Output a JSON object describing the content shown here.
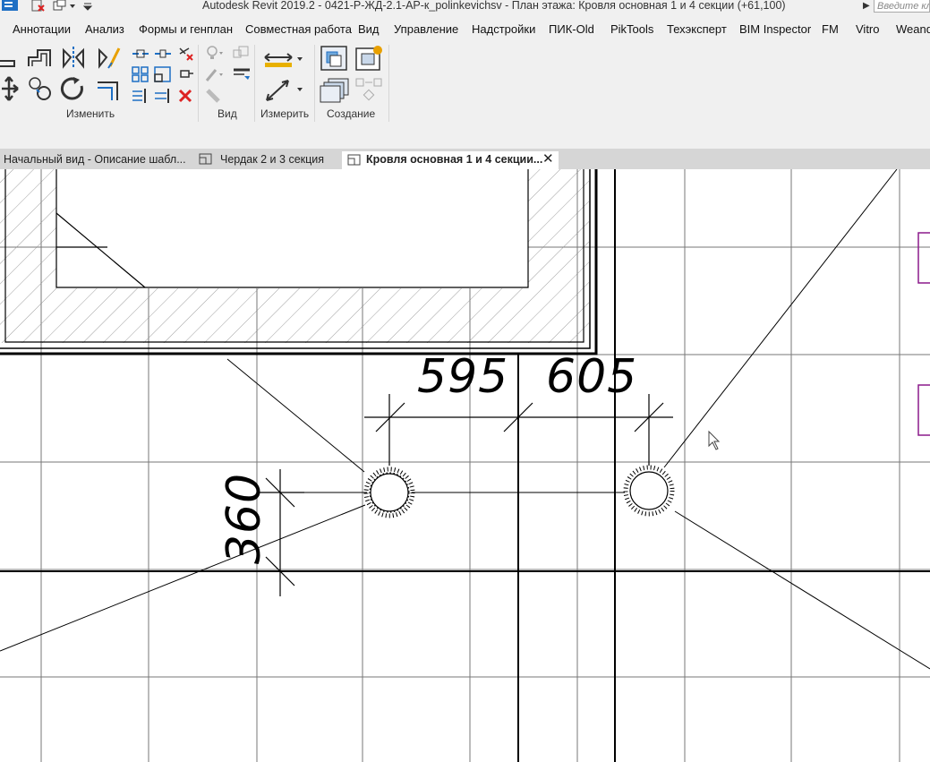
{
  "window": {
    "title": "Autodesk Revit 2019.2 - 0421-Р-ЖД-2.1-АР-к_polinkevichsv - План этажа: Кровля основная 1 и 4 секции  (+61,100)",
    "search_placeholder": "Введите кл"
  },
  "menu": {
    "items": [
      "Аннотации",
      "Анализ",
      "Формы и генплан",
      "Совместная работа",
      "Вид",
      "Управление",
      "Надстройки",
      "ПИК-Old",
      "PikTools",
      "Техэксперт",
      "BIM Inspector",
      "FM",
      "Vitro",
      "Weand"
    ]
  },
  "ribbon": {
    "groups": [
      "Изменить",
      "Вид",
      "Измерить",
      "Создание"
    ]
  },
  "tabs": [
    {
      "label": "Начальный вид - Описание шабл...",
      "active": false
    },
    {
      "label": "Чердак 2 и 3 секция",
      "active": false
    },
    {
      "label": "Кровля основная 1 и 4 секции...",
      "active": true
    }
  ],
  "drawing": {
    "dimensions": [
      "595",
      "605",
      "360"
    ]
  },
  "colors": {
    "chrome": "#f0f0f0",
    "tabbar": "#d6d6d6",
    "accent_magenta": "#8b1a8b",
    "icon_blue": "#1e6fc4"
  }
}
